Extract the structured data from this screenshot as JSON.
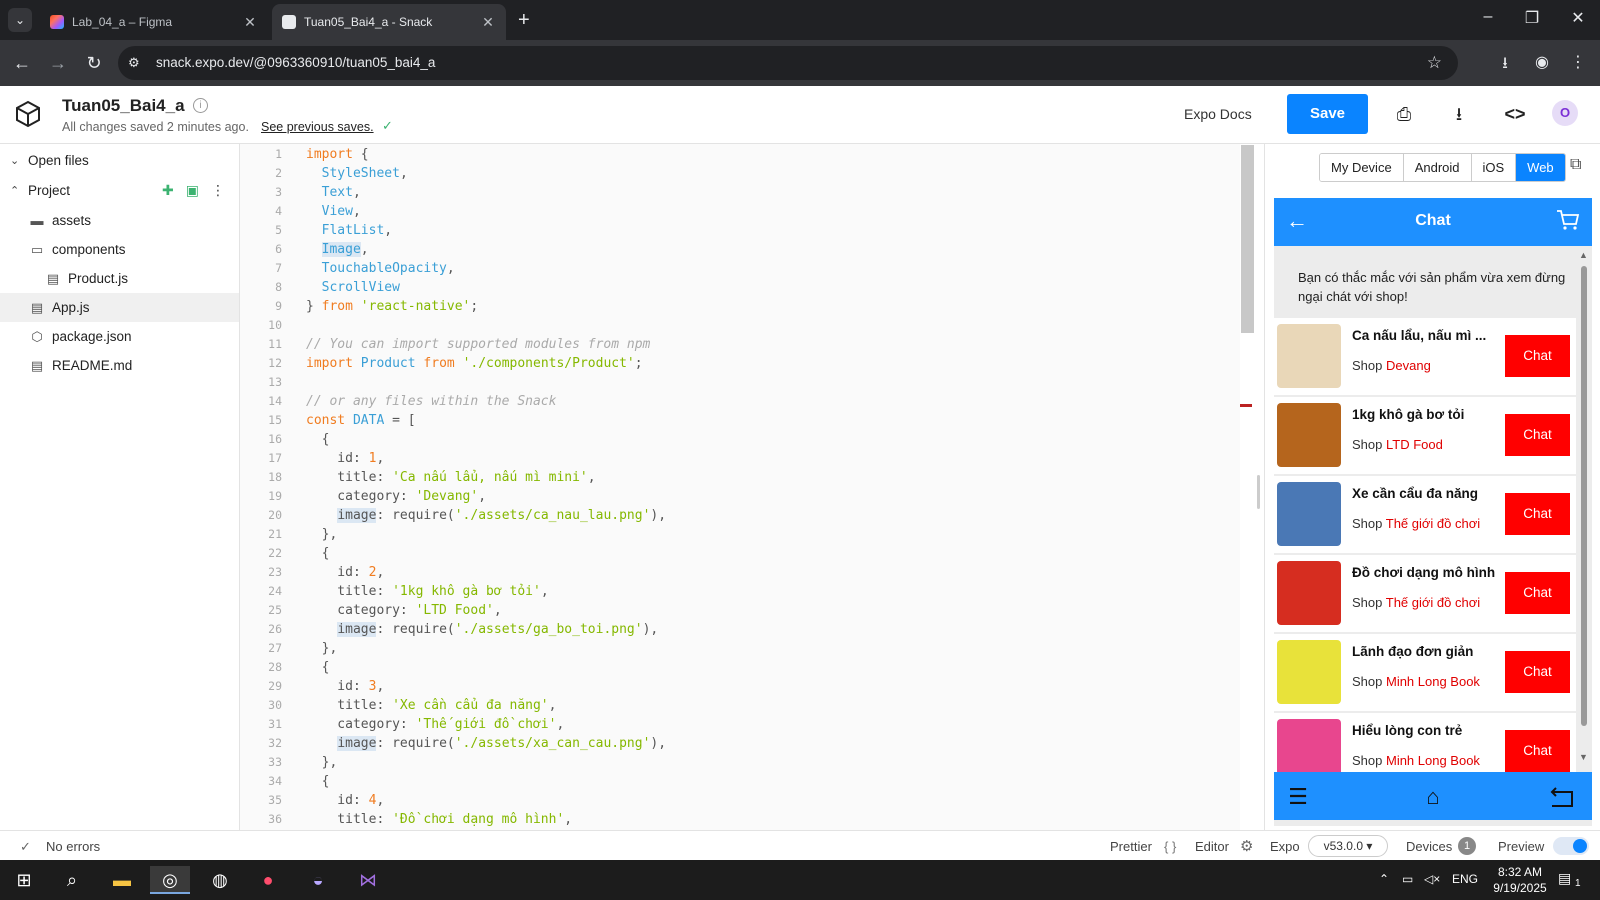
{
  "browser": {
    "tabs": [
      {
        "title": "Lab_04_a – Figma",
        "active": false
      },
      {
        "title": "Tuan05_Bai4_a - Snack",
        "active": true
      }
    ],
    "new_tab": "+",
    "url": "snack.expo.dev/@0963360910/tuan05_bai4_a"
  },
  "header": {
    "project_title": "Tuan05_Bai4_a",
    "info_icon": "i",
    "save_status": "All changes saved 2 minutes ago.",
    "previous_saves_link": "See previous saves.",
    "expo_docs": "Expo Docs",
    "save_label": "Save",
    "avatar_initial": "O"
  },
  "sidebar": {
    "open_files": "Open files",
    "project": "Project",
    "items": [
      {
        "label": "assets",
        "icon": "folder-icon",
        "indent": 0
      },
      {
        "label": "components",
        "icon": "folder-open-icon",
        "indent": 0
      },
      {
        "label": "Product.js",
        "icon": "file-icon",
        "indent": 1
      },
      {
        "label": "App.js",
        "icon": "file-icon",
        "indent": 0,
        "selected": true
      },
      {
        "label": "package.json",
        "icon": "package-icon",
        "indent": 0
      },
      {
        "label": "README.md",
        "icon": "file-icon",
        "indent": 0
      }
    ]
  },
  "editor": {
    "lines": [
      [
        [
          "kw",
          "import"
        ],
        [
          "p",
          " {"
        ]
      ],
      [
        [
          "p",
          "  "
        ],
        [
          "id",
          "StyleSheet"
        ],
        [
          "p",
          ","
        ]
      ],
      [
        [
          "p",
          "  "
        ],
        [
          "id",
          "Text"
        ],
        [
          "p",
          ","
        ]
      ],
      [
        [
          "p",
          "  "
        ],
        [
          "id",
          "View"
        ],
        [
          "p",
          ","
        ]
      ],
      [
        [
          "p",
          "  "
        ],
        [
          "id",
          "FlatList"
        ],
        [
          "p",
          ","
        ]
      ],
      [
        [
          "p",
          "  "
        ],
        [
          "idhl",
          "Image"
        ],
        [
          "p",
          ","
        ]
      ],
      [
        [
          "p",
          "  "
        ],
        [
          "id",
          "TouchableOpacity"
        ],
        [
          "p",
          ","
        ]
      ],
      [
        [
          "p",
          "  "
        ],
        [
          "id",
          "ScrollView"
        ]
      ],
      [
        [
          "p",
          "} "
        ],
        [
          "kw",
          "from"
        ],
        [
          "p",
          " "
        ],
        [
          "str",
          "'react-native'"
        ],
        [
          "p",
          ";"
        ]
      ],
      [],
      [
        [
          "cmt",
          "// You can import supported modules from npm"
        ]
      ],
      [
        [
          "kw",
          "import"
        ],
        [
          "p",
          " "
        ],
        [
          "id",
          "Product"
        ],
        [
          "p",
          " "
        ],
        [
          "kw",
          "from"
        ],
        [
          "p",
          " "
        ],
        [
          "str",
          "'./components/Product'"
        ],
        [
          "p",
          ";"
        ]
      ],
      [],
      [
        [
          "cmt",
          "// or any files within the Snack"
        ]
      ],
      [
        [
          "kw",
          "const"
        ],
        [
          "p",
          " "
        ],
        [
          "id",
          "DATA"
        ],
        [
          "p",
          " = ["
        ]
      ],
      [
        [
          "p",
          "  {"
        ]
      ],
      [
        [
          "p",
          "    id: "
        ],
        [
          "num",
          "1"
        ],
        [
          "p",
          ","
        ]
      ],
      [
        [
          "p",
          "    title: "
        ],
        [
          "str",
          "'Ca nấu lẩu, nấu mì mini'"
        ],
        [
          "p",
          ","
        ]
      ],
      [
        [
          "p",
          "    category: "
        ],
        [
          "str",
          "'Devang'"
        ],
        [
          "p",
          ","
        ]
      ],
      [
        [
          "p",
          "    "
        ],
        [
          "phl",
          "image"
        ],
        [
          "p",
          ": require("
        ],
        [
          "str",
          "'./assets/ca_nau_lau.png'"
        ],
        [
          "p",
          "),"
        ]
      ],
      [
        [
          "p",
          "  },"
        ]
      ],
      [
        [
          "p",
          "  {"
        ]
      ],
      [
        [
          "p",
          "    id: "
        ],
        [
          "num",
          "2"
        ],
        [
          "p",
          ","
        ]
      ],
      [
        [
          "p",
          "    title: "
        ],
        [
          "str",
          "'1kg khô gà bơ tỏi'"
        ],
        [
          "p",
          ","
        ]
      ],
      [
        [
          "p",
          "    category: "
        ],
        [
          "str",
          "'LTD Food'"
        ],
        [
          "p",
          ","
        ]
      ],
      [
        [
          "p",
          "    "
        ],
        [
          "phl",
          "image"
        ],
        [
          "p",
          ": require("
        ],
        [
          "str",
          "'./assets/ga_bo_toi.png'"
        ],
        [
          "p",
          "),"
        ]
      ],
      [
        [
          "p",
          "  },"
        ]
      ],
      [
        [
          "p",
          "  {"
        ]
      ],
      [
        [
          "p",
          "    id: "
        ],
        [
          "num",
          "3"
        ],
        [
          "p",
          ","
        ]
      ],
      [
        [
          "p",
          "    title: "
        ],
        [
          "str",
          "'Xe cần cẩu đa năng'"
        ],
        [
          "p",
          ","
        ]
      ],
      [
        [
          "p",
          "    category: "
        ],
        [
          "str",
          "'Thế giới đồ chơi'"
        ],
        [
          "p",
          ","
        ]
      ],
      [
        [
          "p",
          "    "
        ],
        [
          "phl",
          "image"
        ],
        [
          "p",
          ": require("
        ],
        [
          "str",
          "'./assets/xa_can_cau.png'"
        ],
        [
          "p",
          "),"
        ]
      ],
      [
        [
          "p",
          "  },"
        ]
      ],
      [
        [
          "p",
          "  {"
        ]
      ],
      [
        [
          "p",
          "    id: "
        ],
        [
          "num",
          "4"
        ],
        [
          "p",
          ","
        ]
      ],
      [
        [
          "p",
          "    title: "
        ],
        [
          "str",
          "'Đồ chơi dạng mô hình'"
        ],
        [
          "p",
          ","
        ]
      ]
    ]
  },
  "preview": {
    "device_tabs": [
      "My Device",
      "Android",
      "iOS",
      "Web"
    ],
    "active_tab": "Web",
    "app": {
      "title": "Chat",
      "intro": "Bạn có thắc mắc với sản phẩm vừa xem đừng ngại chát với shop!",
      "shop_prefix": "Shop ",
      "chat_label": "Chat",
      "products": [
        {
          "title": "Ca nấu lẩu, nấu mì ...",
          "shop": "Devang",
          "thumb_color": "#e9d7b8"
        },
        {
          "title": "1kg khô gà bơ tỏi",
          "shop": "LTD Food",
          "thumb_color": "#b5651d"
        },
        {
          "title": "Xe cần cẩu đa năng",
          "shop": "Thế giới đồ chơi",
          "thumb_color": "#4a78b5"
        },
        {
          "title": "Đồ chơi dạng mô hình",
          "shop": "Thế giới đồ chơi",
          "thumb_color": "#d62d20"
        },
        {
          "title": "Lãnh đạo đơn giản",
          "shop": "Minh Long Book",
          "thumb_color": "#e8e23a"
        },
        {
          "title": "Hiểu lòng con trẻ",
          "shop": "Minh Long Book",
          "thumb_color": "#e8468e"
        }
      ]
    }
  },
  "status": {
    "errors": "No errors",
    "prettier": "Prettier",
    "editor": "Editor",
    "expo": "Expo",
    "version": "v53.0.0",
    "devices": "Devices",
    "devices_count": "1",
    "preview": "Preview"
  },
  "taskbar": {
    "lang": "ENG",
    "time": "8:32 AM",
    "date": "9/19/2025",
    "notif_count": "1"
  }
}
